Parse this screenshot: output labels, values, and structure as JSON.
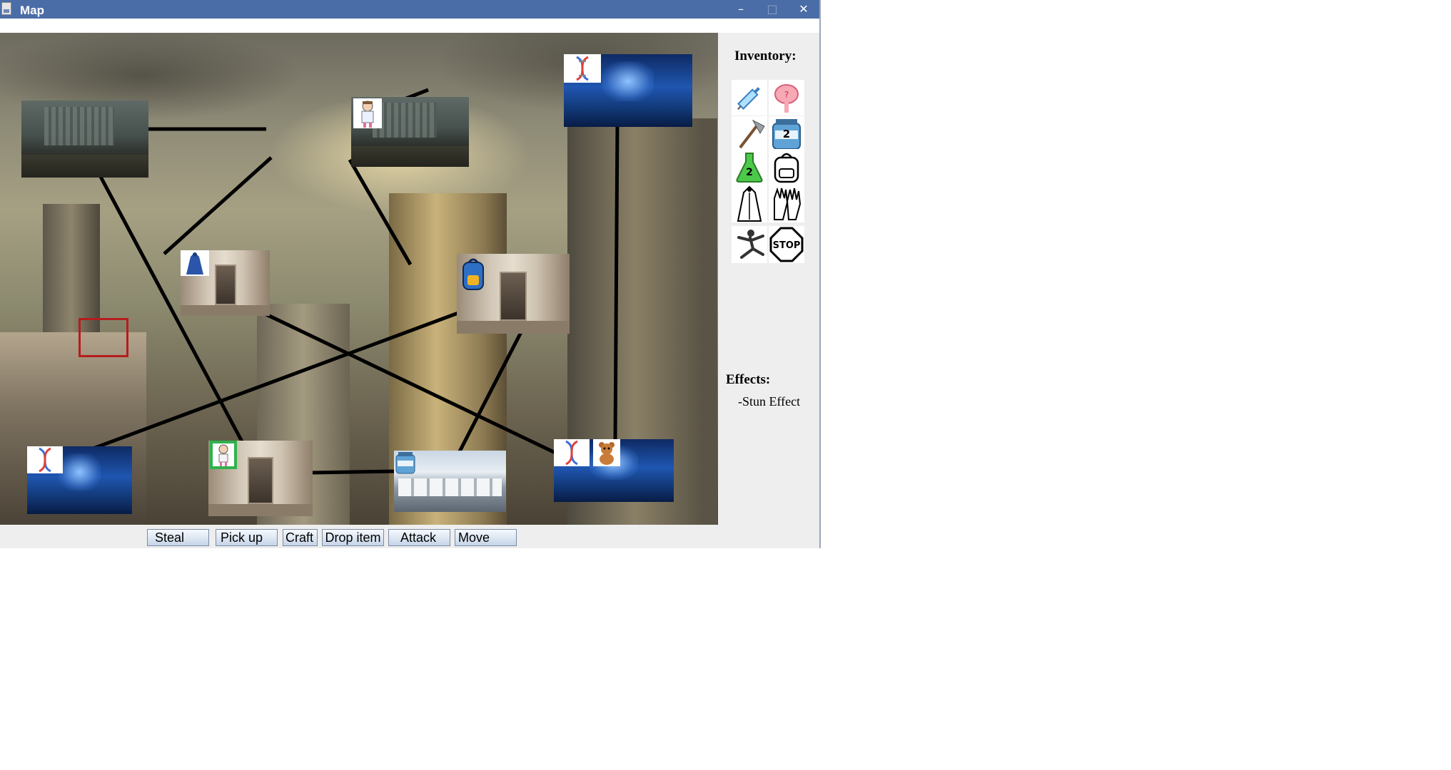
{
  "window": {
    "title": "Map",
    "controls": {
      "minimize": "–",
      "maximize": "□",
      "close": "✕"
    }
  },
  "map": {
    "rooms": [
      {
        "id": "ruins-1",
        "kind": "ruins",
        "items": []
      },
      {
        "id": "ruins-2",
        "kind": "ruins",
        "items": [
          "virologist-icon"
        ]
      },
      {
        "id": "lab-1",
        "kind": "laboratory",
        "items": [
          "dna-icon"
        ]
      },
      {
        "id": "corridor-1",
        "kind": "corridor",
        "items": [
          "cloak-icon"
        ]
      },
      {
        "id": "corridor-2",
        "kind": "corridor",
        "items": [
          "backpack-icon"
        ]
      },
      {
        "id": "lab-2",
        "kind": "laboratory",
        "items": [
          "dna-icon"
        ]
      },
      {
        "id": "corridor-3",
        "kind": "corridor",
        "items": [
          "virologist-icon"
        ],
        "current": true
      },
      {
        "id": "warehouse-1",
        "kind": "warehouse",
        "items": [
          "ammo-jar-icon"
        ]
      },
      {
        "id": "lab-3",
        "kind": "laboratory",
        "items": [
          "dna-icon",
          "teddy-bear-icon"
        ]
      }
    ]
  },
  "inventory": {
    "title": "Inventory:",
    "items": [
      {
        "icon": "syringe-icon"
      },
      {
        "icon": "brain-icon"
      },
      {
        "icon": "axe-icon"
      },
      {
        "icon": "ammo-jar-icon",
        "count": "2"
      },
      {
        "icon": "green-flask-icon",
        "count": "2"
      },
      {
        "icon": "backpack-icon"
      },
      {
        "icon": "cloak-icon"
      },
      {
        "icon": "gloves-icon"
      },
      {
        "icon": "dancer-icon"
      },
      {
        "icon": "stop-sign-icon",
        "label": "STOP"
      }
    ]
  },
  "effects": {
    "title": "Effects:",
    "list": [
      "-Stun Effect"
    ]
  },
  "actions": {
    "steal": "Steal",
    "pick_up": "Pick up",
    "craft": "Craft",
    "drop_item": "Drop item",
    "attack": "Attack",
    "move": "Move"
  },
  "colors": {
    "titlebar": "#4a6da7",
    "selection_border": "#2fb24b",
    "connection_line": "#000000"
  }
}
